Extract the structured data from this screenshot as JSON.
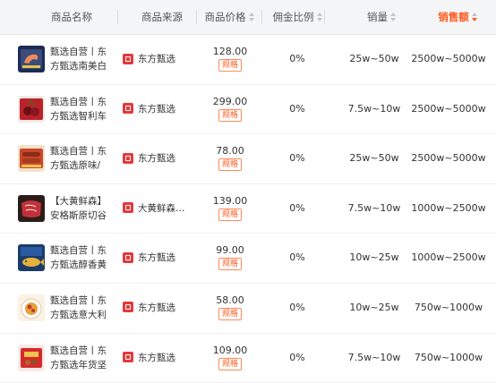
{
  "header": {
    "name": "商品名称",
    "source": "商品来源",
    "price": "商品价格",
    "commission": "佣金比例",
    "volume": "销量",
    "sales": "销售额"
  },
  "spec_label": "规格",
  "rows": [
    {
      "name": "甄选自营丨东方甄选南美白虾 …",
      "source": "东方甄选",
      "price": "128.00",
      "commission": "0%",
      "volume": "25w~50w",
      "sales": "2500w~5000w",
      "thumb": "shrimp"
    },
    {
      "name": "甄选自营丨东方甄选智利车厘…",
      "source": "东方甄选",
      "price": "299.00",
      "commission": "0%",
      "volume": "7.5w~10w",
      "sales": "2500w~5000w",
      "thumb": "cherry"
    },
    {
      "name": "甄选自营丨东方甄选原味/黑…",
      "source": "东方甄选",
      "price": "78.00",
      "commission": "0%",
      "volume": "25w~50w",
      "sales": "2500w~5000w",
      "thumb": "sausage"
    },
    {
      "name": "【大黄鲜森】安格斯原切谷饲…",
      "source": "大黄鲜森…",
      "price": "139.00",
      "commission": "0%",
      "volume": "7.5w~10w",
      "sales": "1000w~2500w",
      "thumb": "beef"
    },
    {
      "name": "甄选自营丨东方甄选醇香黄鱼…",
      "source": "东方甄选",
      "price": "99.00",
      "commission": "0%",
      "volume": "10w~25w",
      "sales": "1000w~2500w",
      "thumb": "fish"
    },
    {
      "name": "甄选自营丨东方甄选意大利面 …",
      "source": "东方甄选",
      "price": "58.00",
      "commission": "0%",
      "volume": "10w~25w",
      "sales": "750w~1000w",
      "thumb": "pasta"
    },
    {
      "name": "甄选自营丨东方甄选年货坚果…",
      "source": "东方甄选",
      "price": "109.00",
      "commission": "0%",
      "volume": "7.5w~10w",
      "sales": "750w~1000w",
      "thumb": "nuts"
    }
  ]
}
